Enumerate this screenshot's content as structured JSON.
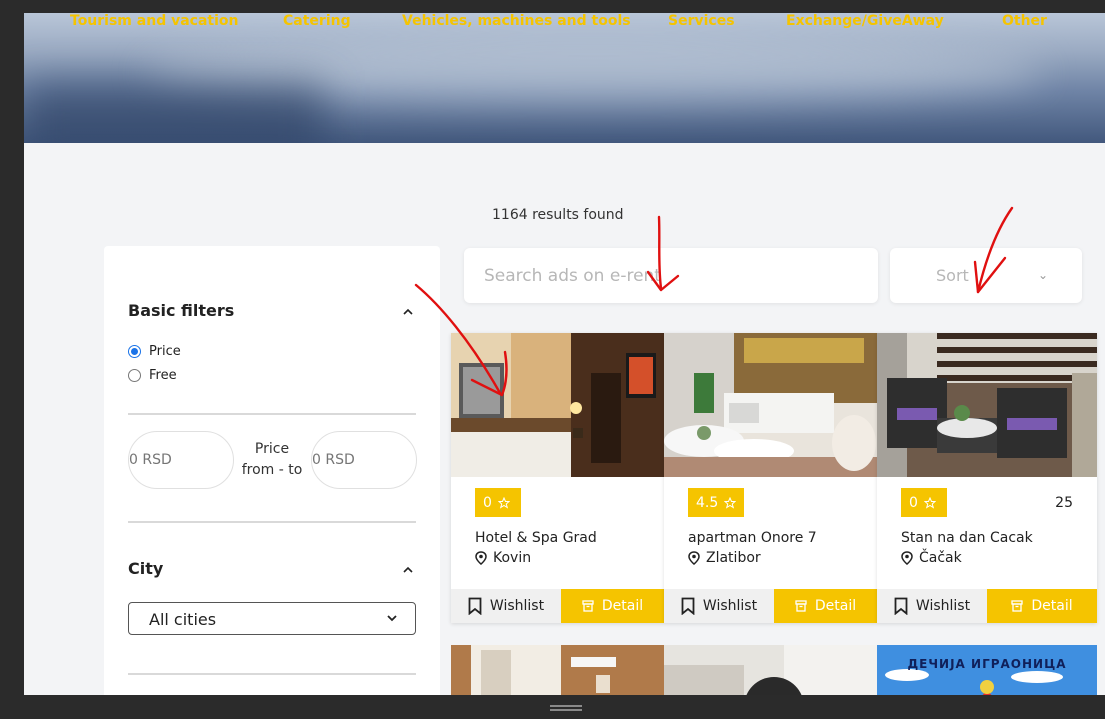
{
  "nav": {
    "items": [
      {
        "label": "Tourism and vacation"
      },
      {
        "label": "Catering"
      },
      {
        "label": "Vehicles, machines and tools"
      },
      {
        "label": "Services"
      },
      {
        "label": "Exchange/GiveAway"
      },
      {
        "label": "Other"
      }
    ]
  },
  "results": {
    "count_text": "1164 results found"
  },
  "search": {
    "placeholder": "Search ads on e-rent"
  },
  "sort": {
    "label": "Sort"
  },
  "filters": {
    "basic_title": "Basic filters",
    "options": [
      {
        "label": "Price",
        "selected": true
      },
      {
        "label": "Free",
        "selected": false
      }
    ],
    "price_from_placeholder": "0 RSD",
    "price_to_placeholder": "0 RSD",
    "price_label_line1": "Price",
    "price_label_line2": "from - to",
    "city_title": "City",
    "city_value": "All cities"
  },
  "cards": [
    {
      "rating": "0",
      "title": "Hotel & Spa Grad",
      "location": "Kovin",
      "count": "",
      "wishlist": "Wishlist",
      "detail": "Detail"
    },
    {
      "rating": "4.5",
      "title": "apartman Onore 7",
      "location": "Zlatibor",
      "count": "",
      "wishlist": "Wishlist",
      "detail": "Detail"
    },
    {
      "rating": "0",
      "title": "Stan na dan Cacak",
      "location": "Čačak",
      "count": "25",
      "wishlist": "Wishlist",
      "detail": "Detail"
    }
  ],
  "second_row": {
    "banner_text": "ДЕЧИЈА ИГРАОНИЦА"
  },
  "colors": {
    "accent": "#f5c400",
    "page_bg": "#f3f4f6",
    "annotation": "#e01010"
  }
}
